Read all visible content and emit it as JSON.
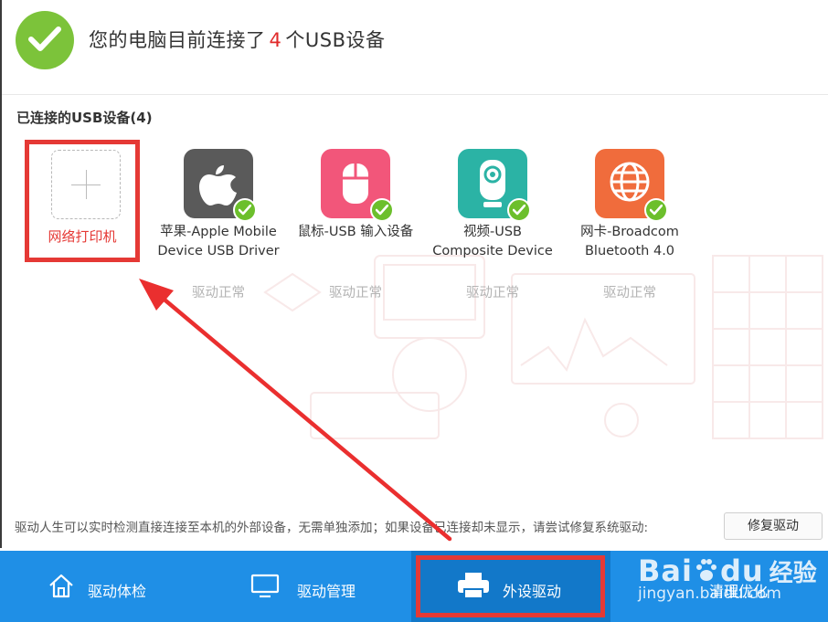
{
  "header": {
    "title_prefix": "您的电脑目前连接了",
    "count": "4",
    "title_suffix": "个USB设备"
  },
  "section": {
    "label": "已连接的USB设备(4)"
  },
  "add_tile": {
    "label": "网络打印机"
  },
  "devices": [
    {
      "line1": "苹果-Apple Mobile",
      "line2": "Device USB Driver",
      "status": "驱动正常",
      "icon": "apple-icon",
      "color": "#5a5a5a"
    },
    {
      "line1": "鼠标-USB 输入设备",
      "line2": "",
      "status": "驱动正常",
      "icon": "mouse-icon",
      "color": "#f2567a"
    },
    {
      "line1": "视频-USB",
      "line2": "Composite Device",
      "status": "驱动正常",
      "icon": "webcam-icon",
      "color": "#2bb3a5"
    },
    {
      "line1": "网卡-Broadcom",
      "line2": "Bluetooth 4.0",
      "status": "驱动正常",
      "icon": "globe-icon",
      "color": "#f06c3c"
    }
  ],
  "footer": {
    "note": "驱动人生可以实时检测直接连接至本机的外部设备，无需单独添加；如果设备已连接却未显示，请尝试修复系统驱动:",
    "repair_button": "修复驱动"
  },
  "nav": [
    {
      "label": "驱动体检",
      "icon": "home-icon"
    },
    {
      "label": "驱动管理",
      "icon": "monitor-icon"
    },
    {
      "label": "外设驱动",
      "icon": "printer-icon",
      "active": true
    },
    {
      "label": "清理优化",
      "icon": "broom-icon"
    }
  ],
  "watermark": {
    "brand": "Bai",
    "brand2": "du",
    "cn": "经验",
    "url": "jingyan.baidu.com"
  },
  "colors": {
    "accent_blue": "#1f8fe6",
    "highlight_red": "#e53935",
    "success_green": "#7cc33a"
  }
}
